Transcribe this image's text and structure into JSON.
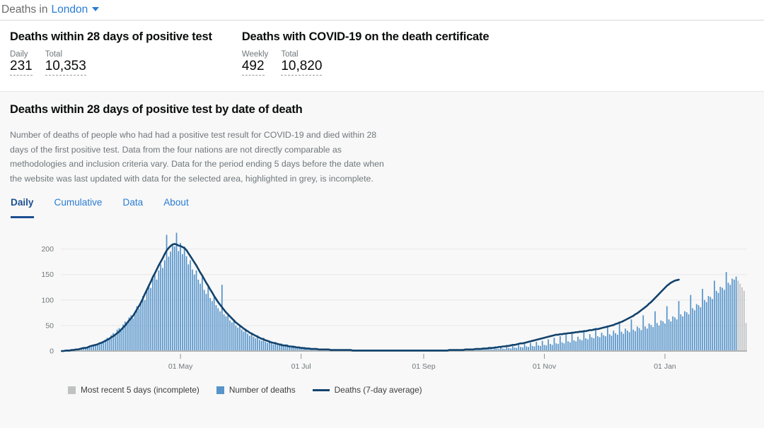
{
  "topbar": {
    "lead_text": "Deaths in",
    "area_name": "London",
    "caret_icon": "chevron-down-icon"
  },
  "summary": {
    "metrics": [
      {
        "title": "Deaths within 28 days of positive test",
        "values": [
          {
            "label": "Daily",
            "number": "231"
          },
          {
            "label": "Total",
            "number": "10,353"
          }
        ]
      },
      {
        "title": "Deaths with COVID-19 on the death certificate",
        "values": [
          {
            "label": "Weekly",
            "number": "492"
          },
          {
            "label": "Total",
            "number": "10,820"
          }
        ]
      }
    ]
  },
  "panel": {
    "title": "Deaths within 28 days of positive test by date of death",
    "description": "Number of deaths of people who had had a positive test result for COVID-19 and died within 28 days of the first positive test. Data from the four nations are not directly comparable as methodologies and inclusion criteria vary. Data for the period ending 5 days before the date when the website was last updated with data for the selected area, highlighted in grey, is incomplete.",
    "tabs": [
      {
        "label": "Daily",
        "active": true
      },
      {
        "label": "Cumulative",
        "active": false
      },
      {
        "label": "Data",
        "active": false
      },
      {
        "label": "About",
        "active": false
      }
    ]
  },
  "colors": {
    "bar_blue": "#5694ca",
    "bar_grey": "#bfc1c3",
    "line_navy": "#12436d",
    "link_blue": "#2b7cd3",
    "tab_active": "#1d4f91",
    "text_dark": "#0b0c0c",
    "text_muted": "#6f777b",
    "gridline": "#e8e8e8",
    "baseline": "#b1b4b6"
  },
  "chart_data": {
    "type": "bar",
    "title": "Deaths within 28 days of positive test by date of death",
    "xlabel": "",
    "ylabel": "",
    "ylim": [
      0,
      230
    ],
    "yticks": [
      0,
      50,
      100,
      150,
      200
    ],
    "grid": true,
    "legend_position": "bottom",
    "legend": [
      {
        "label": "Most recent 5 days (incomplete)",
        "marker": "square",
        "color": "#bfc1c3"
      },
      {
        "label": "Number of deaths",
        "marker": "square",
        "color": "#5694ca"
      },
      {
        "label": "Deaths (7-day average)",
        "marker": "line",
        "color": "#12436d"
      }
    ],
    "xticks": [
      {
        "label": "01 May",
        "index": 60
      },
      {
        "label": "01 Jul",
        "index": 121
      },
      {
        "label": "01 Sep",
        "index": 183
      },
      {
        "label": "01 Nov",
        "index": 244
      },
      {
        "label": "01 Jan",
        "index": 305
      }
    ],
    "incomplete_tail_count": 5,
    "series": [
      {
        "name": "Number of deaths",
        "color": "#5694ca",
        "values": [
          0,
          0,
          1,
          0,
          2,
          1,
          2,
          3,
          2,
          4,
          5,
          4,
          7,
          6,
          9,
          8,
          12,
          11,
          14,
          13,
          18,
          17,
          22,
          26,
          24,
          31,
          35,
          33,
          42,
          45,
          40,
          52,
          58,
          54,
          66,
          70,
          64,
          78,
          88,
          83,
          95,
          108,
          100,
          118,
          130,
          124,
          142,
          150,
          140,
          158,
          170,
          163,
          178,
          228,
          185,
          195,
          210,
          205,
          232,
          196,
          212,
          190,
          205,
          186,
          170,
          178,
          160,
          150,
          158,
          140,
          132,
          145,
          120,
          112,
          126,
          104,
          98,
          110,
          90,
          84,
          78,
          130,
          72,
          68,
          74,
          60,
          56,
          62,
          50,
          46,
          52,
          42,
          38,
          44,
          34,
          30,
          36,
          28,
          25,
          31,
          22,
          20,
          26,
          18,
          16,
          21,
          15,
          13,
          18,
          12,
          11,
          15,
          10,
          9,
          13,
          8,
          7,
          11,
          7,
          6,
          9,
          5,
          5,
          8,
          4,
          4,
          6,
          3,
          3,
          5,
          3,
          2,
          4,
          2,
          2,
          4,
          2,
          2,
          3,
          1,
          1,
          3,
          1,
          1,
          2,
          1,
          1,
          2,
          1,
          1,
          2,
          1,
          1,
          2,
          1,
          0,
          2,
          1,
          1,
          2,
          1,
          1,
          2,
          1,
          1,
          2,
          1,
          1,
          2,
          1,
          1,
          2,
          1,
          1,
          2,
          1,
          1,
          2,
          1,
          1,
          2,
          1,
          1,
          2,
          1,
          1,
          2,
          1,
          1,
          2,
          1,
          1,
          2,
          1,
          1,
          2,
          1,
          1,
          2,
          2,
          1,
          3,
          2,
          1,
          3,
          2,
          2,
          4,
          2,
          2,
          4,
          3,
          2,
          5,
          3,
          3,
          6,
          4,
          3,
          7,
          4,
          4,
          8,
          5,
          4,
          9,
          6,
          5,
          10,
          7,
          6,
          12,
          8,
          7,
          14,
          9,
          8,
          16,
          10,
          9,
          18,
          11,
          10,
          20,
          12,
          11,
          23,
          14,
          12,
          26,
          15,
          14,
          29,
          17,
          15,
          32,
          19,
          17,
          36,
          21,
          19,
          28,
          23,
          21,
          40,
          25,
          23,
          33,
          27,
          25,
          45,
          29,
          27,
          36,
          31,
          29,
          50,
          33,
          30,
          40,
          35,
          32,
          56,
          38,
          34,
          44,
          40,
          37,
          62,
          42,
          39,
          48,
          45,
          41,
          70,
          48,
          44,
          54,
          51,
          47,
          78,
          55,
          50,
          60,
          58,
          54,
          88,
          62,
          58,
          68,
          66,
          62,
          98,
          72,
          68,
          78,
          76,
          72,
          110,
          84,
          80,
          92,
          90,
          86,
          122,
          100,
          96,
          108,
          106,
          102,
          138,
          118,
          114,
          126,
          124,
          120,
          155,
          134,
          130,
          142,
          140,
          146,
          138,
          132,
          125,
          118,
          55
        ]
      },
      {
        "name": "Deaths (7-day average)",
        "color": "#12436d",
        "values": [
          0,
          0,
          1,
          1,
          1,
          2,
          2,
          3,
          3,
          4,
          5,
          6,
          6,
          7,
          9,
          10,
          11,
          12,
          13,
          15,
          16,
          18,
          20,
          22,
          24,
          27,
          29,
          32,
          35,
          38,
          42,
          46,
          50,
          55,
          60,
          64,
          69,
          75,
          82,
          88,
          95,
          103,
          112,
          120,
          128,
          136,
          145,
          152,
          160,
          168,
          175,
          182,
          190,
          197,
          202,
          206,
          209,
          210,
          209,
          207,
          206,
          204,
          202,
          198,
          192,
          186,
          180,
          174,
          168,
          161,
          154,
          148,
          141,
          134,
          128,
          121,
          115,
          108,
          102,
          96,
          91,
          86,
          81,
          76,
          72,
          68,
          64,
          60,
          56,
          53,
          50,
          47,
          44,
          41,
          39,
          36,
          34,
          32,
          30,
          28,
          26,
          24,
          23,
          21,
          20,
          18,
          17,
          16,
          15,
          14,
          13,
          12,
          11,
          11,
          10,
          9,
          9,
          8,
          8,
          7,
          7,
          6,
          6,
          5,
          5,
          5,
          4,
          4,
          4,
          4,
          3,
          3,
          3,
          3,
          3,
          3,
          2,
          2,
          2,
          2,
          2,
          2,
          2,
          2,
          2,
          2,
          2,
          1,
          1,
          1,
          1,
          1,
          1,
          1,
          1,
          1,
          1,
          1,
          1,
          1,
          1,
          1,
          1,
          1,
          1,
          1,
          1,
          1,
          1,
          1,
          1,
          1,
          1,
          1,
          1,
          1,
          1,
          1,
          1,
          1,
          1,
          1,
          1,
          1,
          1,
          1,
          1,
          1,
          1,
          1,
          1,
          1,
          1,
          1,
          1,
          1,
          2,
          2,
          2,
          2,
          2,
          2,
          2,
          2,
          3,
          3,
          3,
          3,
          3,
          4,
          4,
          4,
          4,
          5,
          5,
          5,
          6,
          6,
          6,
          7,
          7,
          8,
          8,
          9,
          9,
          10,
          10,
          11,
          12,
          12,
          13,
          14,
          15,
          15,
          16,
          17,
          18,
          19,
          20,
          21,
          22,
          23,
          24,
          25,
          26,
          27,
          28,
          29,
          30,
          31,
          32,
          32,
          33,
          33,
          34,
          34,
          35,
          35,
          36,
          36,
          37,
          37,
          38,
          38,
          39,
          39,
          40,
          41,
          41,
          42,
          43,
          43,
          44,
          45,
          46,
          47,
          48,
          49,
          50,
          51,
          53,
          54,
          56,
          57,
          59,
          61,
          63,
          65,
          67,
          69,
          72,
          74,
          77,
          80,
          83,
          86,
          89,
          93,
          96,
          100,
          104,
          108,
          112,
          116,
          120,
          124,
          128,
          131,
          134,
          136,
          138,
          139,
          140
        ]
      }
    ]
  }
}
